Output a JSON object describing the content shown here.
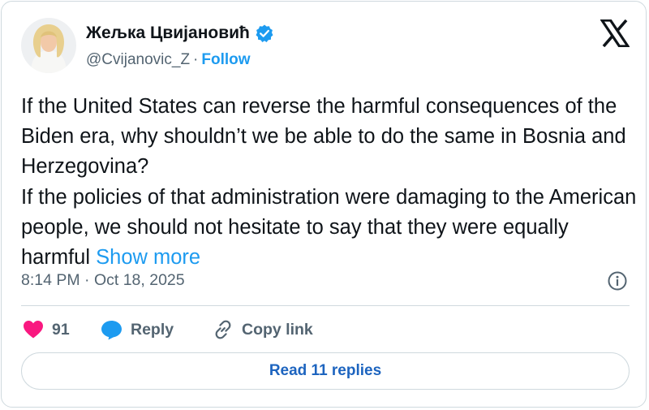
{
  "author": {
    "name": "Жељка Цвијановић",
    "handle": "@Cvijanovic_Z",
    "separator": "·",
    "follow_label": "Follow",
    "verified": true
  },
  "icons": {
    "avatar": "author-avatar",
    "verified": "verified-badge-icon",
    "brand": "x-logo-icon",
    "info": "info-icon",
    "like": "heart-icon",
    "reply": "speech-bubble-icon",
    "copy_link": "link-icon"
  },
  "tweet": {
    "paragraph_1": "If the United States can reverse the harmful consequences of the Biden era, why shouldn’t we be able to do the same in Bosnia and Herzegovina?",
    "paragraph_2": "If the policies of that administration were damaging to the American people, we should not hesitate to say that they were equally harmful",
    "show_more_label": "Show more",
    "timestamp": "8:14 PM · Oct 18, 2025"
  },
  "actions": {
    "like_count": "91",
    "reply_label": "Reply",
    "copy_link_label": "Copy link"
  },
  "read_replies_label": "Read 11 replies",
  "colors": {
    "accent": "#1d9bf0",
    "like": "#f91880",
    "text": "#0f1419",
    "secondary_text": "#536471",
    "border": "#cfd9de",
    "read_replies_text": "#1d64bf"
  }
}
